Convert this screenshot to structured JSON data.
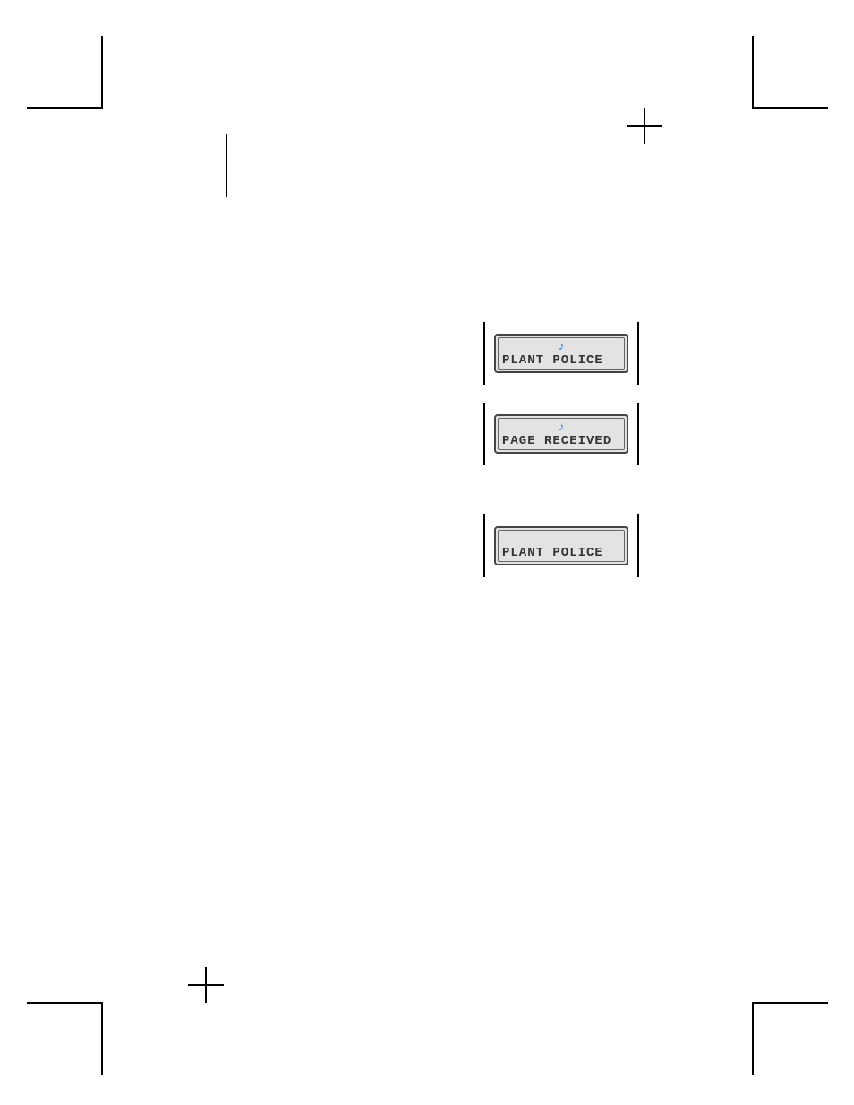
{
  "displays": {
    "d1": {
      "text": "PLANT POLICE",
      "has_note": true
    },
    "d2": {
      "text": "PAGE RECEIVED",
      "has_note": true
    },
    "d3": {
      "text": "PLANT POLICE",
      "has_note": false
    }
  },
  "icons": {
    "music_note": "♪"
  }
}
